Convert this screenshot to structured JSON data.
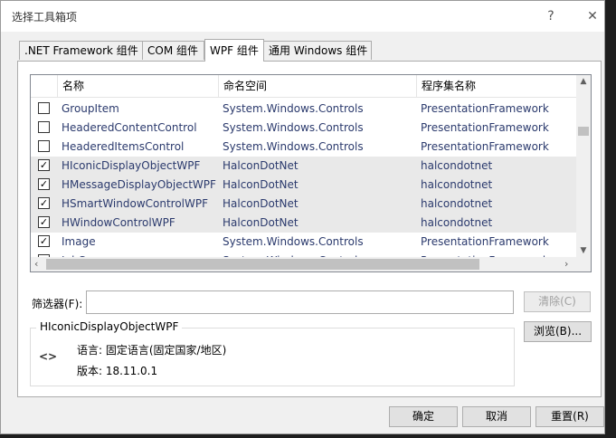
{
  "dialog": {
    "title": "选择工具箱项",
    "help_button": "?",
    "close_button": "✕"
  },
  "tabs": [
    {
      "label": ".NET Framework 组件"
    },
    {
      "label": "COM 组件"
    },
    {
      "label": "WPF 组件",
      "active": true
    },
    {
      "label": "通用 Windows 组件"
    }
  ],
  "list": {
    "columns": [
      "名称",
      "命名空间",
      "程序集名称"
    ],
    "rows": [
      {
        "checked": false,
        "name": "GroupItem",
        "namespace": "System.Windows.Controls",
        "assembly": "PresentationFramework"
      },
      {
        "checked": false,
        "name": "HeaderedContentControl",
        "namespace": "System.Windows.Controls",
        "assembly": "PresentationFramework"
      },
      {
        "checked": false,
        "name": "HeaderedItemsControl",
        "namespace": "System.Windows.Controls",
        "assembly": "PresentationFramework"
      },
      {
        "checked": true,
        "name": "HIconicDisplayObjectWPF",
        "namespace": "HalconDotNet",
        "assembly": "halcondotnet"
      },
      {
        "checked": true,
        "name": "HMessageDisplayObjectWPF",
        "namespace": "HalconDotNet",
        "assembly": "halcondotnet"
      },
      {
        "checked": true,
        "name": "HSmartWindowControlWPF",
        "namespace": "HalconDotNet",
        "assembly": "halcondotnet"
      },
      {
        "checked": true,
        "name": "HWindowControlWPF",
        "namespace": "HalconDotNet",
        "assembly": "halcondotnet"
      },
      {
        "checked": true,
        "name": "Image",
        "namespace": "System.Windows.Controls",
        "assembly": "PresentationFramework"
      },
      {
        "checked": false,
        "name": "InkCanvas",
        "namespace": "System.Windows.Controls",
        "assembly": "PresentationFramework"
      }
    ]
  },
  "filter": {
    "label": "筛选器(F):",
    "value": "",
    "clear_button": "清除(C)"
  },
  "details": {
    "title": "HIconicDisplayObjectWPF",
    "icon": "<>",
    "language": "语言: 固定语言(固定国家/地区)",
    "version": "版本: 18.11.0.1",
    "browse_button": "浏览(B)..."
  },
  "footer": {
    "ok": "确定",
    "cancel": "取消",
    "reset": "重置(R)"
  }
}
